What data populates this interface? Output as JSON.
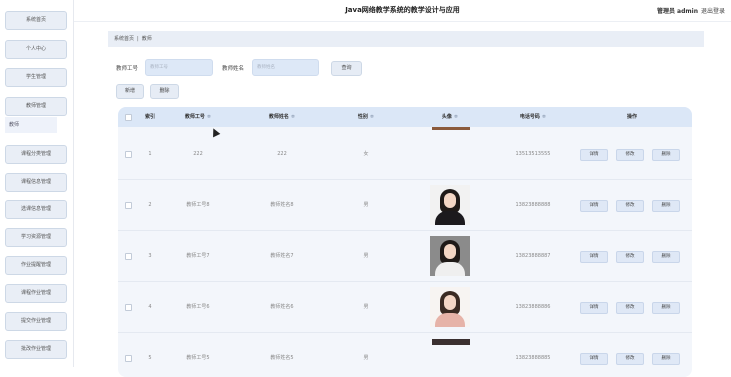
{
  "app": {
    "title": "Java网络教学系统的教学设计与应用"
  },
  "user": {
    "name": "管理员 admin",
    "logout": "退出登录"
  },
  "sidebar": {
    "items": [
      {
        "label": "系统首页"
      },
      {
        "label": "个人中心"
      },
      {
        "label": "学生管理"
      },
      {
        "label": "教师管理"
      },
      {
        "label": "课程分类管理"
      },
      {
        "label": "课程信息管理"
      },
      {
        "label": "选课信息管理"
      },
      {
        "label": "学习资源管理"
      },
      {
        "label": "作业提醒管理"
      },
      {
        "label": "课程作业管理"
      },
      {
        "label": "提交作业管理"
      },
      {
        "label": "批改作业管理"
      }
    ],
    "sub_items": [
      {
        "label": "教师"
      }
    ]
  },
  "breadcrumb": {
    "home": "系统首页",
    "sep": "|",
    "current": "教师"
  },
  "search": {
    "teacher_no_label": "教师工号",
    "teacher_no_placeholder": "教师工号",
    "teacher_name_label": "教师姓名",
    "teacher_name_placeholder": "教师姓名",
    "query_button": "查询"
  },
  "toolbar": {
    "add": "新增",
    "delete": "删除"
  },
  "table": {
    "headers": {
      "index": "索引",
      "teacher_no": "教师工号",
      "teacher_name": "教师姓名",
      "gender": "性别",
      "avatar": "头像",
      "phone": "电话号码",
      "actions": "操作"
    },
    "sort_icon": "≑",
    "rows": [
      {
        "index": "1",
        "teacher_no": "222",
        "teacher_name": "222",
        "gender": "女",
        "phone": "13513513555",
        "avatar": "none"
      },
      {
        "index": "2",
        "teacher_no": "教师工号8",
        "teacher_name": "教师姓名8",
        "gender": "男",
        "phone": "13823888888",
        "avatar": "woman-black-dress"
      },
      {
        "index": "3",
        "teacher_no": "教师工号7",
        "teacher_name": "教师姓名7",
        "gender": "男",
        "phone": "13823888887",
        "avatar": "woman-white-blazer"
      },
      {
        "index": "4",
        "teacher_no": "教师工号6",
        "teacher_name": "教师姓名6",
        "gender": "男",
        "phone": "13823888886",
        "avatar": "woman-pink-top"
      },
      {
        "index": "5",
        "teacher_no": "教师工号5",
        "teacher_name": "教师姓名5",
        "gender": "男",
        "phone": "13823888885",
        "avatar": "none"
      }
    ],
    "row_actions": {
      "detail": "详情",
      "edit": "修改",
      "delete": "删除"
    }
  },
  "colors": {
    "sidebar_button": "#e9eef6",
    "table_header": "#dbe7f7",
    "table_body": "#f3f6fb",
    "input_bg": "#dde8f7"
  }
}
